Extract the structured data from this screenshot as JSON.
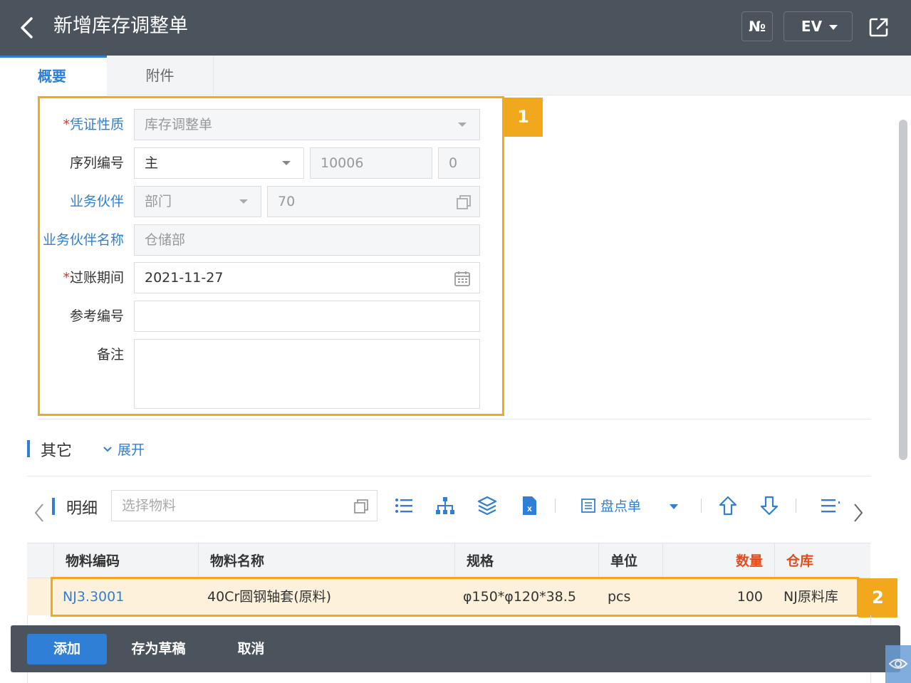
{
  "header": {
    "title": "新增库存调整单",
    "no_label": "№",
    "ev_label": "EV"
  },
  "tabs": [
    {
      "label": "概要"
    },
    {
      "label": "附件"
    }
  ],
  "form": {
    "voucher_type": {
      "label": "凭证性质",
      "value": "库存调整单"
    },
    "serial": {
      "label": "序列编号",
      "series": "主",
      "number": "10006",
      "suffix": "0"
    },
    "partner": {
      "label": "业务伙伴",
      "type": "部门",
      "code": "70"
    },
    "partner_name": {
      "label": "业务伙伴名称",
      "value": "仓储部"
    },
    "posting_date": {
      "label": "过账期间",
      "value": "2021-11-27"
    },
    "reference": {
      "label": "参考编号",
      "value": ""
    },
    "remark": {
      "label": "备注",
      "value": ""
    }
  },
  "badges": {
    "one": "1",
    "two": "2"
  },
  "other_section": {
    "title": "其它",
    "expand_label": "展开"
  },
  "detail": {
    "title": "明细",
    "material_placeholder": "选择物料",
    "stocktake_label": "盘点单",
    "columns": [
      "物料编码",
      "物料名称",
      "规格",
      "单位",
      "数量",
      "仓库"
    ],
    "rows": [
      {
        "code": "NJ3.3001",
        "name": "40Cr圆钢轴套(原料)",
        "spec": "φ150*φ120*38.5",
        "unit": "pcs",
        "qty": "100",
        "warehouse": "NJ原料库"
      }
    ]
  },
  "footer": {
    "add_label": "添加",
    "draft_label": "存为草稿",
    "cancel_label": "取消"
  },
  "colors": {
    "header_bg": "#4b535c",
    "accent": "#2f7fd6",
    "highlight": "#f2a81d",
    "row_highlight": "#fdf1dc",
    "required": "#e03030"
  }
}
